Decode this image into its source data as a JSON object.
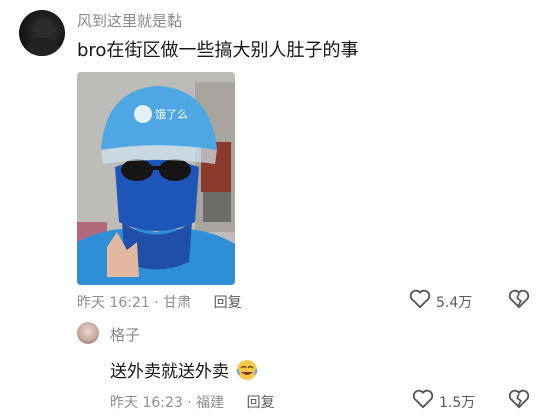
{
  "comment": {
    "username": "风到这里就是黏",
    "text": "bro在街区做一些搞大别人肚子的事",
    "photo": {
      "icon": "photo-delivery-rider-helmet"
    },
    "time": "昨天 16:21",
    "location": "甘肃",
    "reply_label": "回复",
    "like_count": "5.4万"
  },
  "reply": {
    "username": "格子",
    "text": "送外卖就送外卖",
    "emoji": "laughing-crying-emoji",
    "time": "昨天 16:23",
    "location": "福建",
    "reply_label": "回复",
    "like_count": "1.5万"
  }
}
